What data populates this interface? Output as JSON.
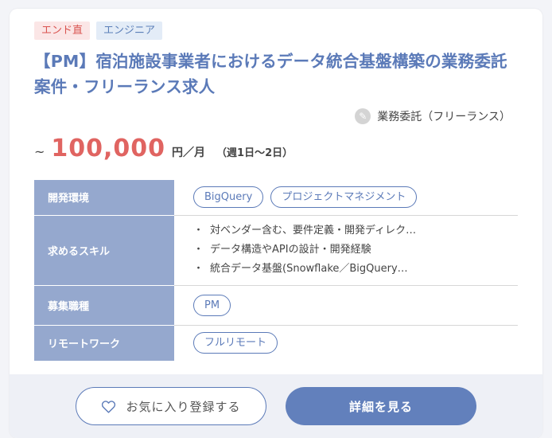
{
  "tags": [
    "エンド直",
    "エンジニア"
  ],
  "title": "【PM】宿泊施設事業者におけるデータ統合基盤構築の業務委託案件・フリーランス求人",
  "contract_type": "業務委託（フリーランス）",
  "salary": {
    "prefix": "~",
    "amount": "100,000",
    "unit": "円／月",
    "note": "（週1日〜2日）"
  },
  "spec": {
    "env_label": "開発環境",
    "env_tags": [
      "BigQuery",
      "プロジェクトマネジメント"
    ],
    "skills_label": "求めるスキル",
    "skills": [
      "対ベンダー含む、要件定義・開発ディレク…",
      "データ構造やAPIの設計・開発経験",
      "統合データ基盤(Snowflake／BigQuery…"
    ],
    "role_label": "募集職種",
    "role_tags": [
      "PM"
    ],
    "remote_label": "リモートワーク",
    "remote_tags": [
      "フルリモート"
    ]
  },
  "buttons": {
    "favorite": "お気に入り登録する",
    "detail": "詳細を見る"
  },
  "icons": {
    "contract": "pencil-icon",
    "favorite": "heart-icon"
  },
  "colors": {
    "accent": "#5b7ab8",
    "price": "#e06461",
    "tag_end_bg": "#fbe6e6",
    "tag_eng_bg": "#e3ecf7",
    "table_header": "#95a8ce",
    "button_primary": "#6280bc"
  }
}
